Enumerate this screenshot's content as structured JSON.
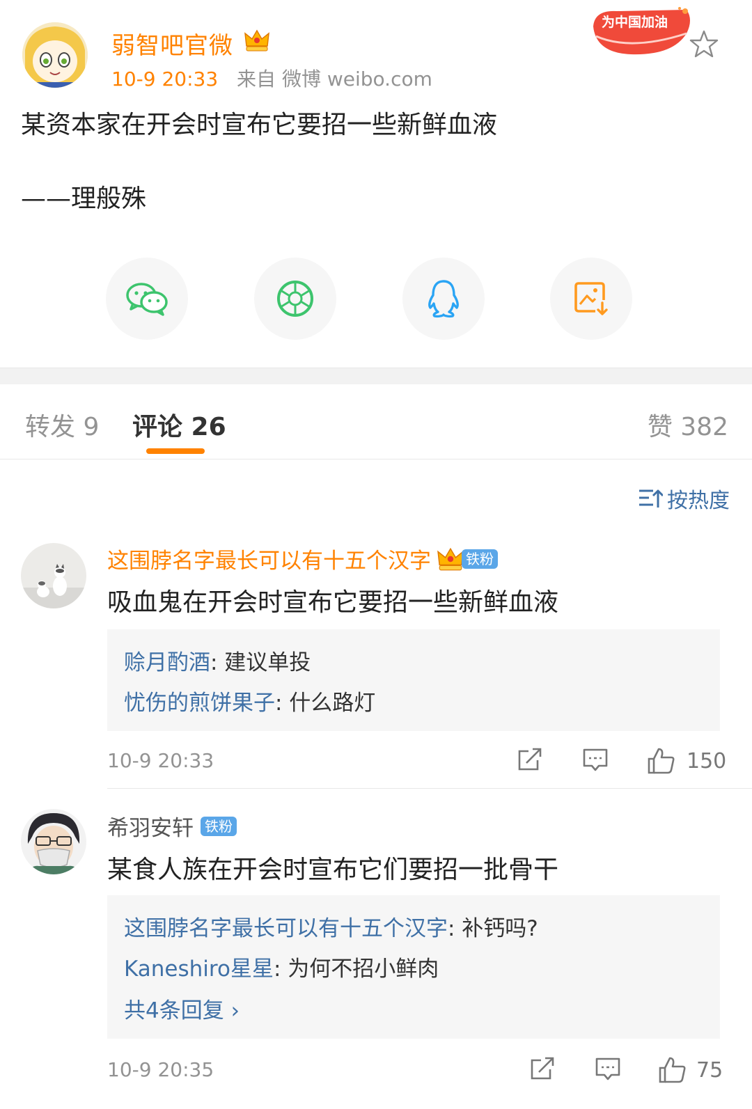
{
  "post": {
    "author": "弱智吧官微",
    "time": "10-9 20:33",
    "source": "来自 微博 weibo.com",
    "badge_text": "为中国加油",
    "text": "某资本家在开会时宣布它要招一些新鲜血液",
    "signature": "——理般殊",
    "share_icons": [
      "wechat-icon",
      "moments-icon",
      "qq-icon",
      "save-image-icon"
    ]
  },
  "tabs": {
    "forward": "转发 9",
    "comment": "评论 26",
    "like": "赞 382"
  },
  "sort_label": "按热度",
  "comments": [
    {
      "user": "这围脖名字最长可以有十五个汉字",
      "badge": "铁粉",
      "text": "吸血鬼在开会时宣布它要招一些新鲜血液",
      "replies": [
        {
          "user": "赊月酌酒",
          "text": ": 建议单投"
        },
        {
          "user": "忧伤的煎饼果子",
          "text": ": 什么路灯"
        }
      ],
      "time": "10-9 20:33",
      "likes": "150"
    },
    {
      "user": "希羽安轩",
      "badge": "铁粉",
      "text": "某食人族在开会时宣布它们要招一批骨干",
      "replies": [
        {
          "user": "这围脖名字最长可以有十五个汉字",
          "text": ": 补钙吗?"
        },
        {
          "user": "Kaneshiro星星",
          "text": ": 为何不招小鲜肉"
        }
      ],
      "more_replies": "共4条回复 ›",
      "time": "10-9 20:35",
      "likes": "75"
    }
  ],
  "colors": {
    "accent_orange": "#ff8200",
    "link_blue": "#3f70a6",
    "fan_badge": "#5aa6e8"
  }
}
